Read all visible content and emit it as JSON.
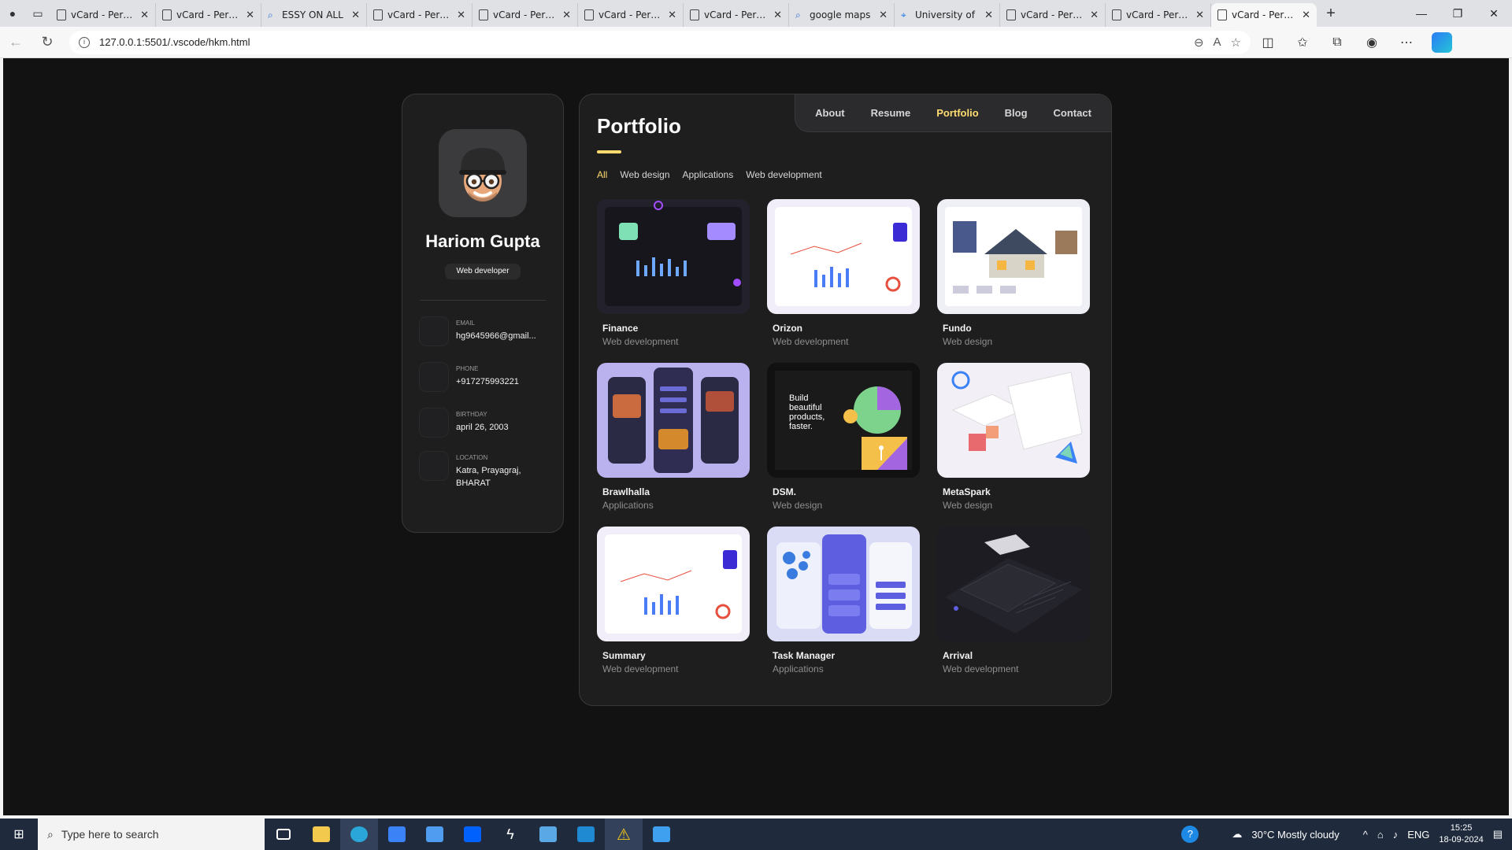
{
  "browser": {
    "tabs": [
      {
        "title": "vCard - Personal Portfolio",
        "icon": "page-icon"
      },
      {
        "title": "vCard - Personal Portfolio",
        "icon": "page-icon"
      },
      {
        "title": "ESSY ON ALL",
        "icon": "search-icon"
      },
      {
        "title": "vCard - Personal Portfolio",
        "icon": "page-icon"
      },
      {
        "title": "vCard - Personal Portfolio",
        "icon": "page-icon"
      },
      {
        "title": "vCard - Personal Portfolio",
        "icon": "page-icon"
      },
      {
        "title": "vCard - Personal Portfolio",
        "icon": "page-icon"
      },
      {
        "title": "google maps",
        "icon": "search-icon"
      },
      {
        "title": "University of",
        "icon": "map-pin-icon"
      },
      {
        "title": "vCard - Personal Portfolio",
        "icon": "page-icon"
      },
      {
        "title": "vCard - Personal Portfolio",
        "icon": "page-icon"
      },
      {
        "title": "vCard - Personal Portfolio",
        "icon": "page-icon"
      }
    ],
    "active_tab_index": 11,
    "url": "127.0.0.1:5501/.vscode/hkm.html"
  },
  "sidebar": {
    "name": "Hariom Gupta",
    "role": "Web developer",
    "contacts": [
      {
        "label": "Email",
        "value": "hg9645966@gmail..."
      },
      {
        "label": "Phone",
        "value": "+917275993221"
      },
      {
        "label": "Birthday",
        "value": "april 26, 2003"
      },
      {
        "label": "Location",
        "value": "Katra, Prayagraj, BHARAT"
      }
    ]
  },
  "navbar": {
    "items": [
      "About",
      "Resume",
      "Portfolio",
      "Blog",
      "Contact"
    ],
    "active": "Portfolio"
  },
  "portfolio": {
    "title": "Portfolio",
    "filters": [
      "All",
      "Web design",
      "Applications",
      "Web development"
    ],
    "active_filter": "All",
    "projects": [
      {
        "title": "Finance",
        "category": "Web development",
        "theme": "dark-dashboard"
      },
      {
        "title": "Orizon",
        "category": "Web development",
        "theme": "light-dashboard"
      },
      {
        "title": "Fundo",
        "category": "Web design",
        "theme": "real-estate"
      },
      {
        "title": "Brawlhalla",
        "category": "Applications",
        "theme": "mobile-app"
      },
      {
        "title": "DSM.",
        "category": "Web design",
        "theme": "dark-shapes"
      },
      {
        "title": "MetaSpark",
        "category": "Web design",
        "theme": "light-isometric"
      },
      {
        "title": "Summary",
        "category": "Web development",
        "theme": "light-dashboard"
      },
      {
        "title": "Task Manager",
        "category": "Applications",
        "theme": "mobile-app-light"
      },
      {
        "title": "Arrival",
        "category": "Web development",
        "theme": "dark-isometric"
      }
    ]
  },
  "taskbar": {
    "search_placeholder": "Type here to search",
    "weather": "30°C  Mostly cloudy",
    "language": "ENG",
    "time": "15:25",
    "date": "18-09-2024"
  },
  "colors": {
    "accent": "#ffdb70",
    "card_bg": "#1e1e1f",
    "page_bg": "#121212"
  }
}
